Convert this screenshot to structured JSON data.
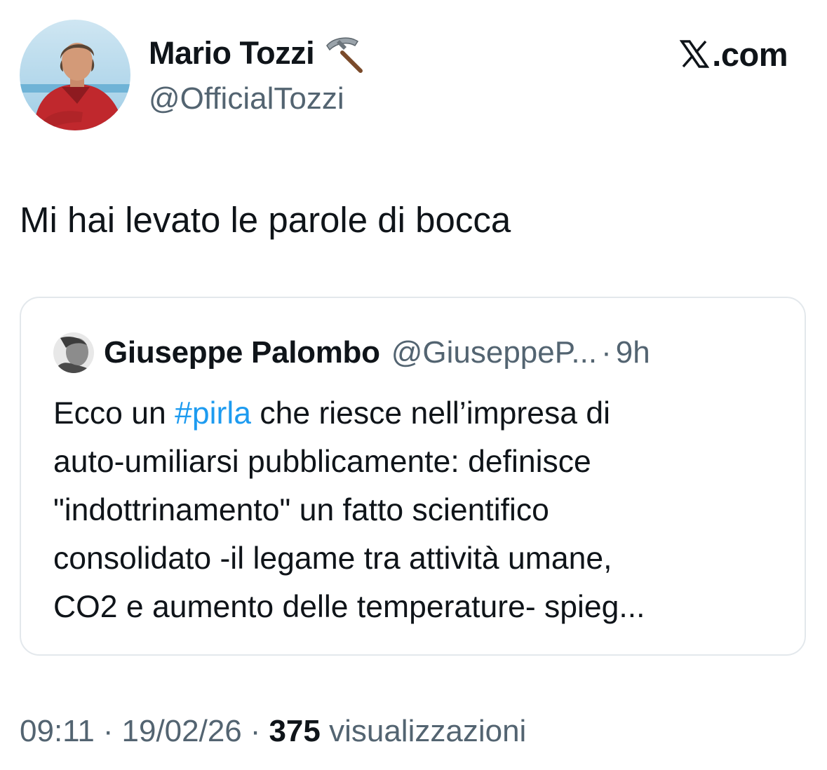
{
  "author": {
    "name": "Mario Tozzi",
    "handle": "@OfficialTozzi",
    "badge_icon": "pickaxe-icon"
  },
  "brand": {
    "logo_icon": "x-logo-icon",
    "domain": ".com"
  },
  "tweet": {
    "text": "Mi hai levato le parole di bocca"
  },
  "quoted_tweet": {
    "author_name": "Giuseppe Palombo",
    "author_handle": "@GiuseppeP...",
    "separator": "·",
    "time": "9h",
    "lines": [
      {
        "before": "Ecco un ",
        "hashtag": "#pirla",
        "after": " che riesce nell’impresa di"
      },
      {
        "text": "auto-umiliarsi pubblicamente: definisce"
      },
      {
        "text": "\"indottrinamento\" un fatto scientifico"
      },
      {
        "text": "consolidato -il legame tra attività umane,"
      },
      {
        "text": "CO2 e aumento delle temperature- spieg..."
      }
    ]
  },
  "meta": {
    "time": "09:11",
    "date": "19/02/26",
    "separator": "·",
    "views_count": "375",
    "views_label": "visualizzazioni"
  },
  "colors": {
    "text_primary": "#0f1419",
    "text_secondary": "#536471",
    "link": "#1d9bf0",
    "card_border": "#e3e8ec"
  }
}
